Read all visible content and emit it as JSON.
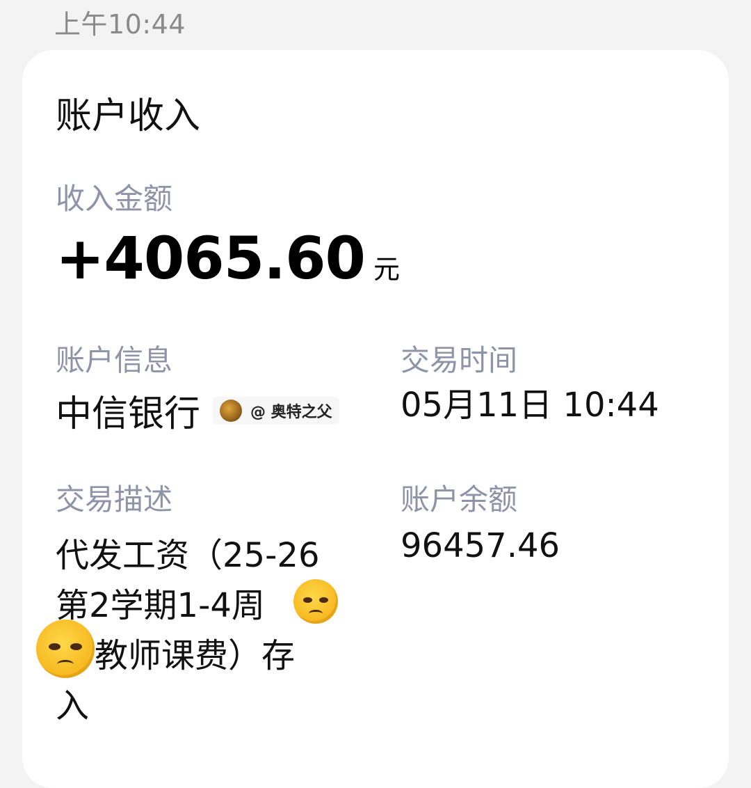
{
  "status_bar": {
    "time": "上午10:44"
  },
  "card": {
    "title": "账户收入",
    "amount_label": "收入金额",
    "amount": "+4065.60",
    "amount_unit": "元",
    "account_label": "账户信息",
    "account_value": "中信银行",
    "watermark_text": "@ 奥特之父",
    "time_label": "交易时间",
    "time_value": "05月11日 10:44",
    "desc_label": "交易描述",
    "desc_lines": [
      "代发工资（25-26",
      "第2学期1-4周",
      "教师课费）存",
      "入"
    ],
    "balance_label": "账户余额",
    "balance_value": "96457.46"
  },
  "icons": [
    "watermark-avatar-icon",
    "pensive-face-emoji-icon"
  ]
}
